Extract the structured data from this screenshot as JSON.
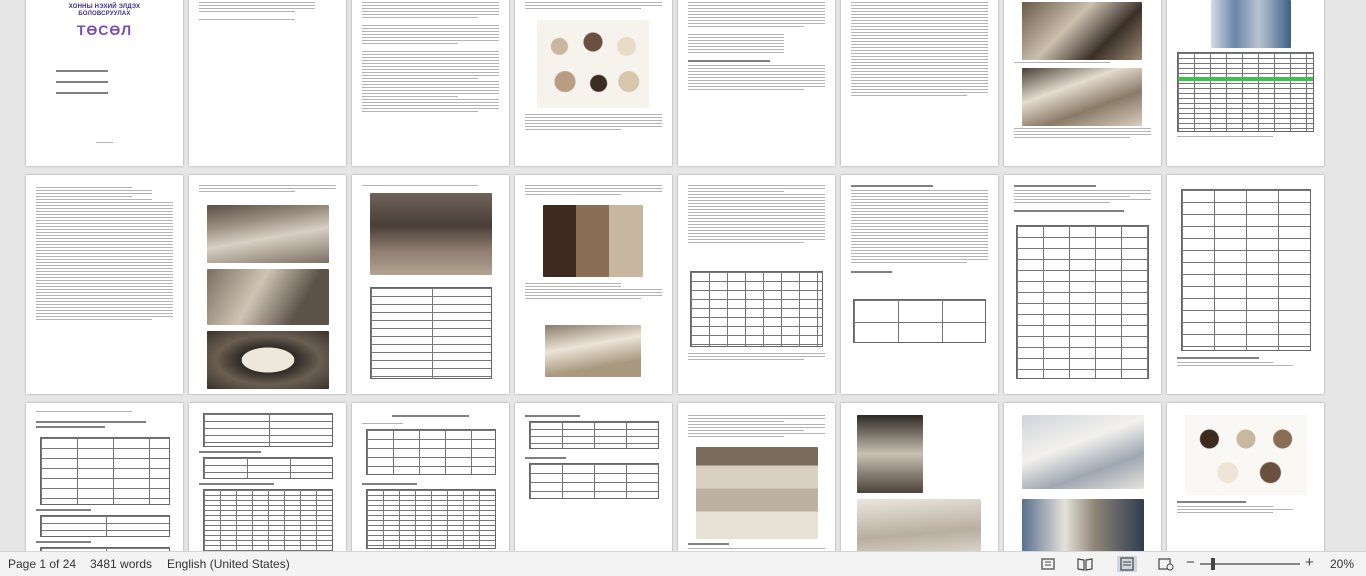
{
  "document": {
    "cover_title_line1": "ХОННЫ НЭХИЙ ЭЛДЭХ",
    "cover_title_line2": "БОЛОВСРУУЛАХ",
    "cover_title_brand": "ТӨСӨЛ"
  },
  "status_bar": {
    "page_info": "Page 1 of 24",
    "word_count": "3481 words",
    "language": "English (United States)",
    "zoom_level": "20%",
    "zoom_minus_label": "−",
    "zoom_plus_label": "+",
    "icons": [
      "focus-mode-icon",
      "read-mode-icon",
      "print-layout-icon",
      "web-layout-icon"
    ]
  },
  "colors": {
    "accent_purple": "#7a4ab8",
    "table_highlight": "#3cc24a",
    "status_bar_bg": "#f3f3f3"
  }
}
